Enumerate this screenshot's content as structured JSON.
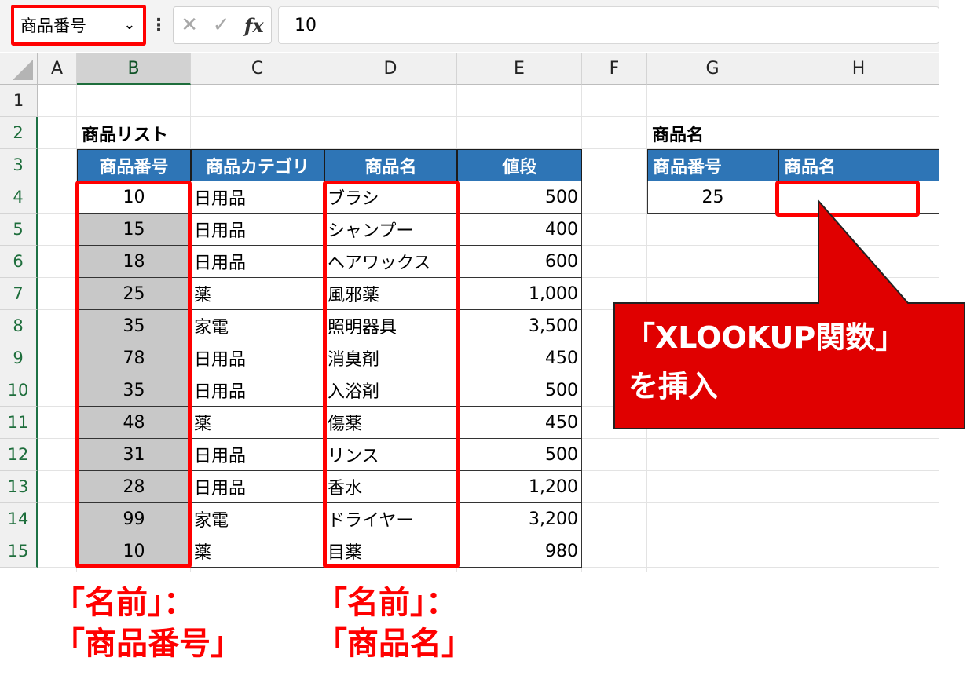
{
  "formula_bar": {
    "name_box": "商品番号",
    "dots": "⋮",
    "cancel_icon": "✕",
    "enter_icon": "✓",
    "fx": "fx",
    "formula": "10"
  },
  "columns": [
    "A",
    "B",
    "C",
    "D",
    "E",
    "F",
    "G",
    "H"
  ],
  "rows": [
    "1",
    "2",
    "3",
    "4",
    "5",
    "6",
    "7",
    "8",
    "9",
    "10",
    "11",
    "12",
    "13",
    "14",
    "15"
  ],
  "product_list": {
    "title": "商品リスト",
    "headers": [
      "商品番号",
      "商品カテゴリ",
      "商品名",
      "値段"
    ],
    "rows": [
      [
        "10",
        "日用品",
        "ブラシ",
        "500"
      ],
      [
        "15",
        "日用品",
        "シャンプー",
        "400"
      ],
      [
        "18",
        "日用品",
        "ヘアワックス",
        "600"
      ],
      [
        "25",
        "薬",
        "風邪薬",
        "1,000"
      ],
      [
        "35",
        "家電",
        "照明器具",
        "3,500"
      ],
      [
        "78",
        "日用品",
        "消臭剤",
        "450"
      ],
      [
        "35",
        "日用品",
        "入浴剤",
        "500"
      ],
      [
        "48",
        "薬",
        "傷薬",
        "450"
      ],
      [
        "31",
        "日用品",
        "リンス",
        "500"
      ],
      [
        "28",
        "日用品",
        "香水",
        "1,200"
      ],
      [
        "99",
        "家電",
        "ドライヤー",
        "3,200"
      ],
      [
        "10",
        "薬",
        "目薬",
        "980"
      ]
    ]
  },
  "lookup": {
    "title": "商品名",
    "headers": [
      "商品番号",
      "商品名"
    ],
    "input": "25",
    "result": ""
  },
  "callout": {
    "line1": "「XLOOKUP関数」",
    "line2": "を挿入"
  },
  "notes": {
    "left_line1": "「名前」：",
    "left_line2": "「商品番号」",
    "right_line1": "「名前」：",
    "right_line2": "「商品名」"
  },
  "colors": {
    "header_blue": "#2e75b6",
    "highlight_red": "#ff0000",
    "callout_red": "#e00000",
    "selected_gray": "#c8c8c8"
  }
}
